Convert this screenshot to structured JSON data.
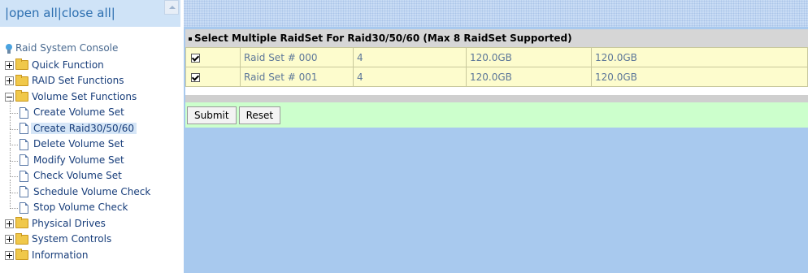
{
  "nav": {
    "open_all": "open all",
    "close_all": "close all",
    "pipe": "|"
  },
  "tree": {
    "root_label": "Raid System Console",
    "items": [
      {
        "label": "Quick Function"
      },
      {
        "label": "RAID Set Functions"
      },
      {
        "label": "Volume Set Functions"
      },
      {
        "label": "Physical Drives"
      },
      {
        "label": "System Controls"
      },
      {
        "label": "Information"
      }
    ],
    "volume_children": [
      {
        "label": "Create Volume Set"
      },
      {
        "label": "Create Raid30/50/60"
      },
      {
        "label": "Delete Volume Set"
      },
      {
        "label": "Modify Volume Set"
      },
      {
        "label": "Check Volume Set"
      },
      {
        "label": "Schedule Volume Check"
      },
      {
        "label": "Stop Volume Check"
      }
    ]
  },
  "main": {
    "title": "Select Multiple RaidSet For Raid30/50/60 (Max 8 RaidSet Supported)",
    "rows": [
      {
        "name": "Raid Set # 000",
        "disks": "4",
        "total": "120.0GB",
        "free": "120.0GB",
        "checked": true
      },
      {
        "name": "Raid Set # 001",
        "disks": "4",
        "total": "120.0GB",
        "free": "120.0GB",
        "checked": true
      }
    ],
    "submit_label": "Submit",
    "reset_label": "Reset"
  }
}
